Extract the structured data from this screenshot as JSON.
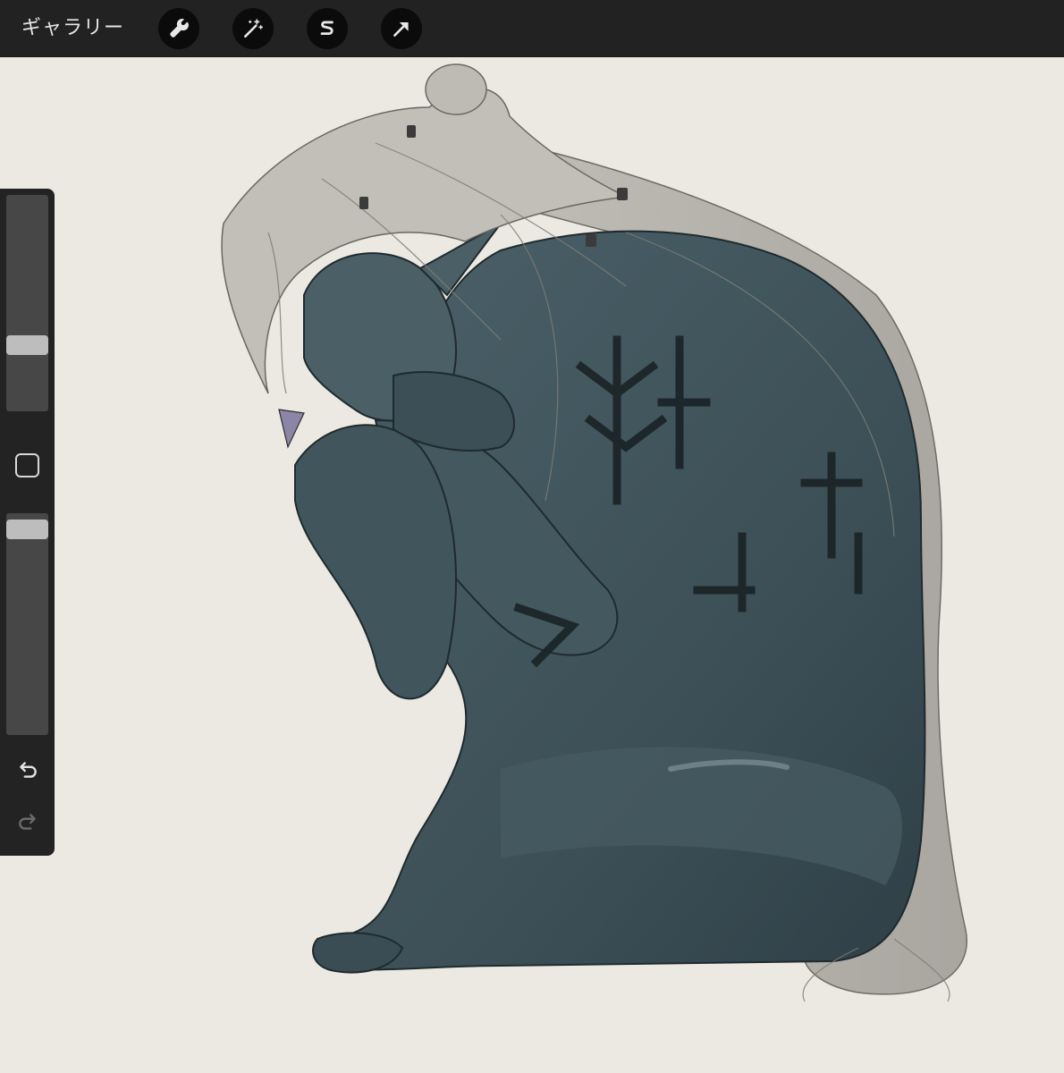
{
  "toolbar": {
    "gallery_label": "ギャラリー",
    "tools": [
      {
        "name": "actions",
        "icon": "wrench-icon"
      },
      {
        "name": "adjustments",
        "icon": "magic-wand-icon"
      },
      {
        "name": "selection",
        "icon": "selection-s-icon"
      },
      {
        "name": "transform",
        "icon": "arrow-cursor-icon"
      }
    ]
  },
  "sidebar": {
    "brush_size": {
      "icon": "brush-size-slider",
      "level": 0.61
    },
    "modify_button": {
      "icon": "square-icon"
    },
    "opacity": {
      "icon": "opacity-slider",
      "level": 0.97
    },
    "undo": {
      "icon": "undo-icon"
    },
    "redo": {
      "icon": "redo-icon",
      "enabled": false
    }
  },
  "canvas": {
    "background_color": "#ece9e2",
    "artwork": "kneeling-figure-illustration"
  },
  "colors": {
    "toolbar_bg": "#222222",
    "tool_button_bg": "#0b0b0b",
    "skin": "#3e525a",
    "hair": "#b8b5ae",
    "tattoo": "#1a2326"
  }
}
